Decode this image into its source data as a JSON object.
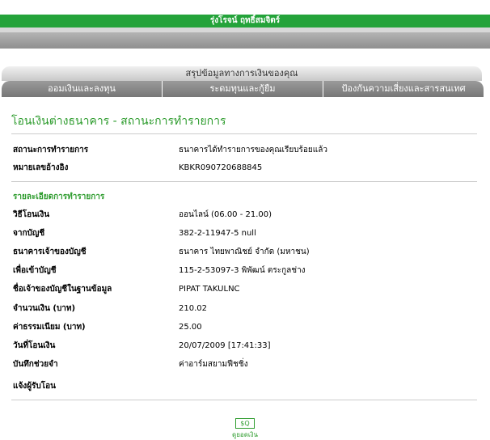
{
  "header": {
    "bank_title": "รุ่งโรจน์ ฤทธิ์สมจิตร์"
  },
  "summary_tab": "สรุปข้อมูลทางการเงินของคุณ",
  "tabs": [
    {
      "label": "ออมเงินและลงทุน"
    },
    {
      "label": "ระดมทุนและกู้ยืม"
    },
    {
      "label": "ป้องกันความเสี่ยงและสารสนเทศ"
    }
  ],
  "page_title": "โอนเงินต่างธนาคาร - สถานะการทำรายการ",
  "status": {
    "rows": [
      {
        "label": "สถานะการทำรายการ",
        "value": "ธนาคารได้ทำรายการของคุณเรียบร้อยแล้ว"
      },
      {
        "label": "หมายเลขอ้างอิง",
        "value": "KBKR090720688845"
      }
    ]
  },
  "details": {
    "section_title": "รายละเอียดการทำรายการ",
    "rows": [
      {
        "label": "วิธีโอนเงิน",
        "value": "ออนไลน์ (06.00 - 21.00)"
      },
      {
        "label": "จากบัญชี",
        "value": "382-2-11947-5 null"
      },
      {
        "label": "ธนาคารเจ้าของบัญชี",
        "value": "ธนาคาร ไทยพาณิชย์ จำกัด (มหาชน)"
      },
      {
        "label": "เพื่อเข้าบัญชี",
        "value": "115-2-53097-3 พิพัฒน์ ตระกูลช่าง"
      },
      {
        "label": "ชื่อเจ้าของบัญชีในฐานข้อมูล",
        "value": "PIPAT TAKULNC"
      },
      {
        "label": "จำนวนเงิน (บาท)",
        "value": "210.02"
      },
      {
        "label": "ค่าธรรมเนียม (บาท)",
        "value": "25.00"
      },
      {
        "label": "วันที่โอนเงิน",
        "value": "20/07/2009 [17:41:33]"
      },
      {
        "label": "บันทึกช่วยจำ",
        "value": "ค่าอาร์มสยามฟีชชิ่ง"
      },
      {
        "label": "แจ้งผู้รับโอน",
        "value": ""
      }
    ]
  },
  "footer": {
    "icon_text": "$Q",
    "link_label": "ดูยอดเงิน"
  }
}
